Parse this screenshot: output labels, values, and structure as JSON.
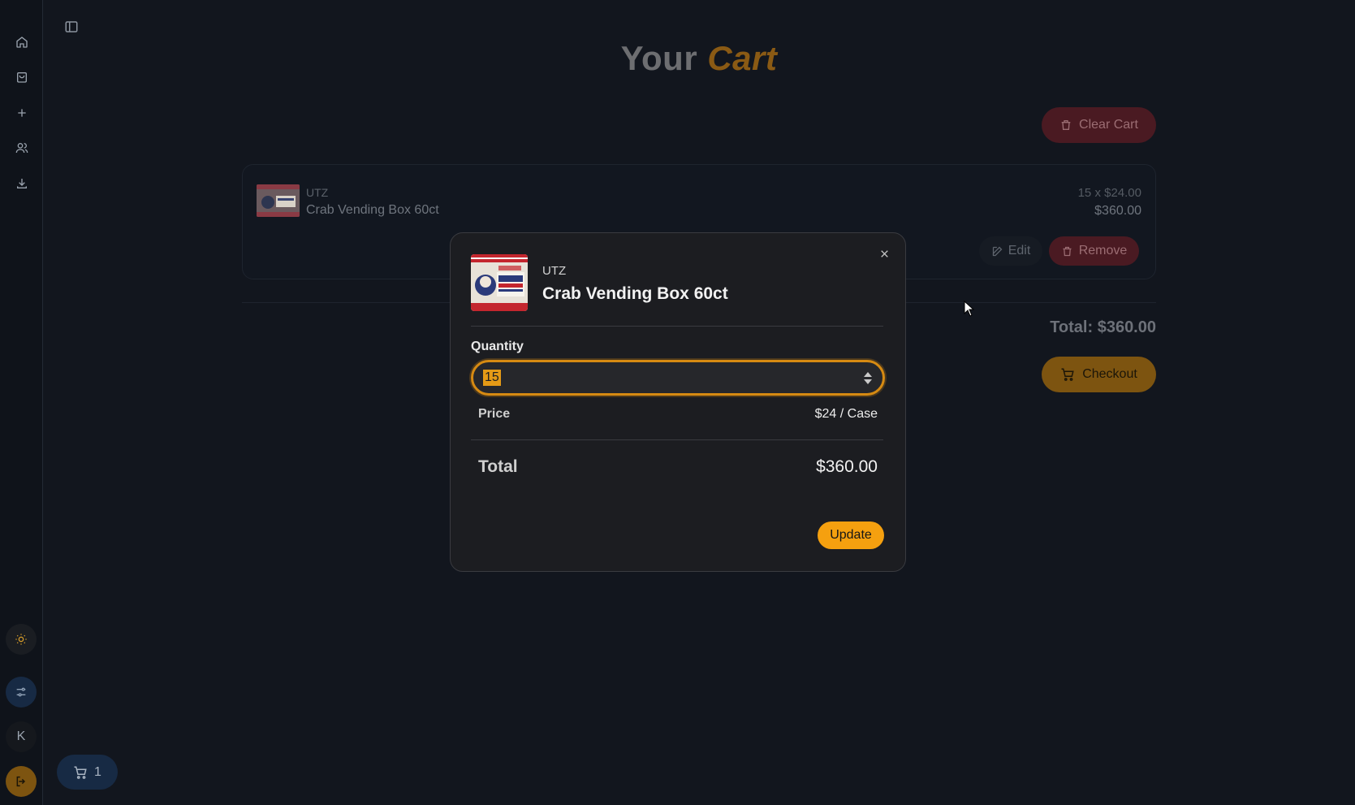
{
  "page": {
    "title_part1": "Your",
    "title_part2": "Cart"
  },
  "cart": {
    "clear_label": "Clear Cart",
    "item": {
      "brand": "UTZ",
      "name": "Crab Vending Box 60ct",
      "qty_line": "15 x $24.00",
      "subtotal": "$360.00",
      "edit_label": "Edit",
      "remove_label": "Remove"
    },
    "total_text": "Total: $360.00",
    "checkout_label": "Checkout",
    "badge_count": "1"
  },
  "sidebar": {
    "avatar_initial": "K",
    "icons": [
      "home-icon",
      "shopping-bag-icon",
      "plus-icon",
      "users-icon",
      "download-icon",
      "sun-icon",
      "sliders-icon",
      "logout-icon"
    ]
  },
  "modal": {
    "brand": "UTZ",
    "product_name": "Crab Vending Box 60ct",
    "quantity_label": "Quantity",
    "quantity_value": "15",
    "price_label": "Price",
    "price_value": "$24 / Case",
    "total_label": "Total",
    "total_value": "$360.00",
    "update_label": "Update"
  },
  "colors": {
    "accent": "#f5a00f",
    "danger": "#4a1a22",
    "background": "#12161e"
  }
}
